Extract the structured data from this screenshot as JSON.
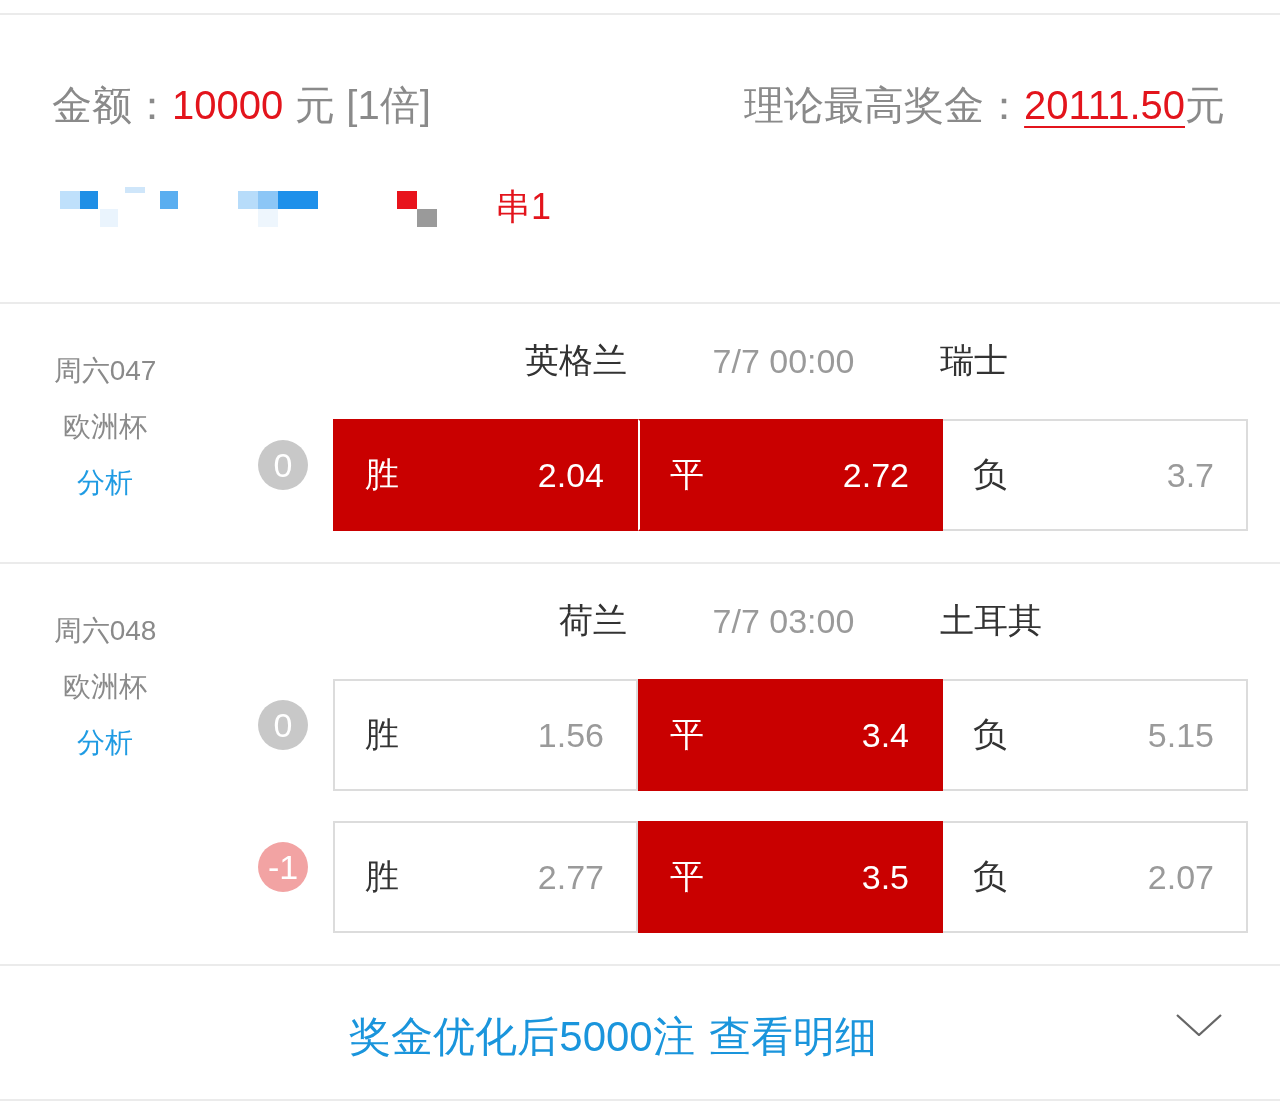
{
  "summary": {
    "amount_label": "金额：",
    "amount": "10000",
    "amount_unit": "元 [1倍]",
    "max_prize_label": "理论最高奖金：",
    "max_prize": "20111.50",
    "max_prize_unit": "元"
  },
  "pass_type": "串1",
  "matches": [
    {
      "number": "周六047",
      "league": "欧洲杯",
      "analysis_link": "分析",
      "home": "英格兰",
      "time": "7/7 00:00",
      "away": "瑞士",
      "lines": [
        {
          "handicap": "0",
          "color": "#c8c8c8",
          "options": [
            {
              "label": "胜",
              "odds": "2.04",
              "selected": true
            },
            {
              "label": "平",
              "odds": "2.72",
              "selected": true
            },
            {
              "label": "负",
              "odds": "3.7",
              "selected": false
            }
          ]
        }
      ]
    },
    {
      "number": "周六048",
      "league": "欧洲杯",
      "analysis_link": "分析",
      "home": "荷兰",
      "time": "7/7 03:00",
      "away": "土耳其",
      "lines": [
        {
          "handicap": "0",
          "color": "#c8c8c8",
          "options": [
            {
              "label": "胜",
              "odds": "1.56",
              "selected": false
            },
            {
              "label": "平",
              "odds": "3.4",
              "selected": true
            },
            {
              "label": "负",
              "odds": "5.15",
              "selected": false
            }
          ]
        },
        {
          "handicap": "-1",
          "color": "#f2a3a3",
          "options": [
            {
              "label": "胜",
              "odds": "2.77",
              "selected": false
            },
            {
              "label": "平",
              "odds": "3.5",
              "selected": true
            },
            {
              "label": "负",
              "odds": "2.07",
              "selected": false
            }
          ]
        }
      ]
    }
  ],
  "footer": {
    "summary": "奖金优化后5000注",
    "details_link": "查看明细"
  }
}
